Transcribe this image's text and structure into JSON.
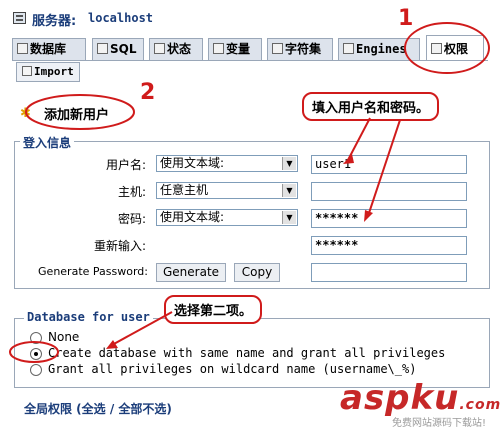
{
  "server": {
    "label": "服务器:",
    "host": "localhost"
  },
  "tabs": [
    {
      "label": "数据库",
      "icon": "database-icon"
    },
    {
      "label": "SQL",
      "icon": "sql-icon"
    },
    {
      "label": "状态",
      "icon": "status-icon"
    },
    {
      "label": "变量",
      "icon": "variables-icon"
    },
    {
      "label": "字符集",
      "icon": "charset-icon"
    },
    {
      "label": "Engines",
      "icon": "engines-icon"
    },
    {
      "label": "权限",
      "icon": "privileges-icon",
      "active": true
    }
  ],
  "import_tab": "Import",
  "add_user": "添加新用户",
  "login": {
    "legend": "登入信息",
    "username_label": "用户名:",
    "username_mode": "使用文本域:",
    "username_value": "user1",
    "host_label": "主机:",
    "host_mode": "任意主机",
    "host_value": "",
    "password_label": "密码:",
    "password_mode": "使用文本域:",
    "password_value": "******",
    "retype_label": "重新输入:",
    "retype_value": "******",
    "genpw_label": "Generate Password:",
    "generate_btn": "Generate",
    "copy_btn": "Copy",
    "genpw_value": ""
  },
  "database": {
    "legend": "Database for user",
    "options": [
      {
        "label": "None",
        "selected": false
      },
      {
        "label": "Create database with same name and grant all privileges",
        "selected": true
      },
      {
        "label": "Grant all privileges on wildcard name (username\\_%)",
        "selected": false
      }
    ]
  },
  "global_privileges": "全局权限 (全选 / 全部不选)",
  "annotations": {
    "num1": "1",
    "num2": "2",
    "fill_hint": "填入用户名和密码。",
    "choose_hint": "选择第二项。"
  },
  "watermark": {
    "main": "aspku",
    "suffix": ".com",
    "sub": "免费网站源码下载站!"
  },
  "colors": {
    "accent": "#d01b1b",
    "link": "#1b3d7a",
    "tab_bg": "#dde3ec"
  }
}
